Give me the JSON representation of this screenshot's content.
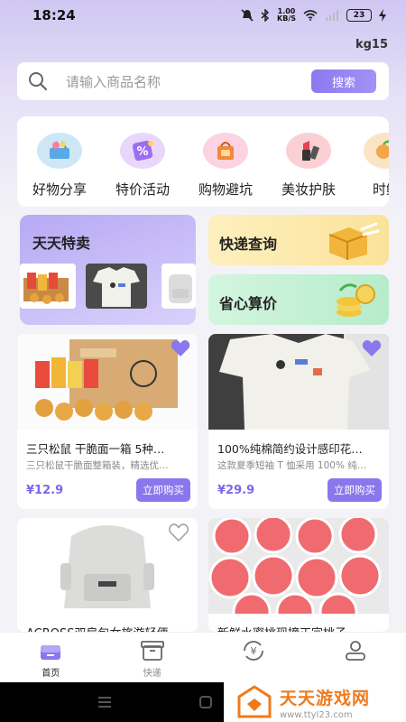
{
  "status_bar": {
    "time": "18:24",
    "net_speed_top": "1.00",
    "net_speed_bottom": "KB/S",
    "battery": "23"
  },
  "user": {
    "name": "kg15"
  },
  "search": {
    "placeholder": "请输入商品名称",
    "button_label": "搜索"
  },
  "categories": [
    {
      "label": "好物分享",
      "icon": "shopping-basket-icon"
    },
    {
      "label": "特价活动",
      "icon": "percent-tag-icon"
    },
    {
      "label": "购物避坑",
      "icon": "shopping-bag-icon"
    },
    {
      "label": "美妆护肤",
      "icon": "lipstick-icon"
    },
    {
      "label": "时鲜",
      "icon": "fresh-food-icon"
    }
  ],
  "promos": {
    "daily_sale": "天天特卖",
    "express_query": "快递查询",
    "save_money": "省心算价"
  },
  "products": [
    {
      "title": "三只松鼠 干脆面一箱 5种…",
      "desc": "三只松鼠干脆面整箱装，精选优…",
      "price": "¥12.9",
      "buy": "立即购买",
      "favorited": true
    },
    {
      "title": "100%纯棉简约设计感印花…",
      "desc": "这款夏季短袖 T 恤采用 100% 纯…",
      "price": "¥29.9",
      "buy": "立即购买",
      "favorited": true
    },
    {
      "title": "ACROSS双肩包女旅游轻便…",
      "favorited": false
    },
    {
      "title": "新鲜水蜜桃现摘正宗桃子…",
      "favorited": false
    }
  ],
  "bottom_nav": [
    {
      "label": "首页",
      "icon": "home-icon",
      "active": true
    },
    {
      "label": "快递",
      "icon": "package-icon",
      "active": false
    },
    {
      "label": "",
      "icon": "price-compare-icon",
      "active": false
    },
    {
      "label": "",
      "icon": "profile-icon",
      "active": false
    }
  ],
  "watermark": {
    "title": "天天游戏网",
    "url": "www.ttyl23.com"
  },
  "colors": {
    "accent": "#8a77ee",
    "price": "#7b68e8",
    "yellow_tile": "#fbe9a8",
    "green_tile": "#c8f1d8",
    "purple_tile": "#b8abf2"
  }
}
